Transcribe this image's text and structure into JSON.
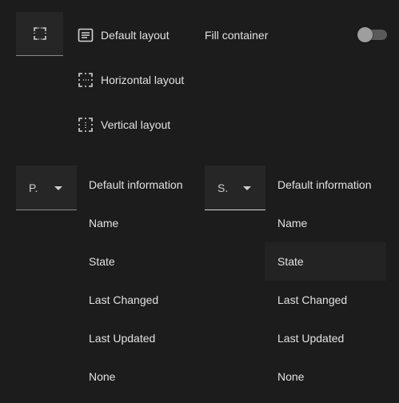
{
  "layout": {
    "picker_icon": "focus-frame-icon",
    "options": [
      {
        "label": "Default layout",
        "icon": "list-layout-icon"
      },
      {
        "label": "Horizontal layout",
        "icon": "horizontal-frame-icon"
      },
      {
        "label": "Vertical layout",
        "icon": "vertical-frame-icon"
      }
    ]
  },
  "fill_container": {
    "label": "Fill container",
    "enabled": false
  },
  "primary_select": {
    "value": "P.",
    "menu": [
      "Default information",
      "Name",
      "State",
      "Last Changed",
      "Last Updated",
      "None"
    ]
  },
  "secondary_select": {
    "value": "S.",
    "menu": [
      "Default information",
      "Name",
      "State",
      "Last Changed",
      "Last Updated",
      "None"
    ],
    "highlighted": "State"
  }
}
